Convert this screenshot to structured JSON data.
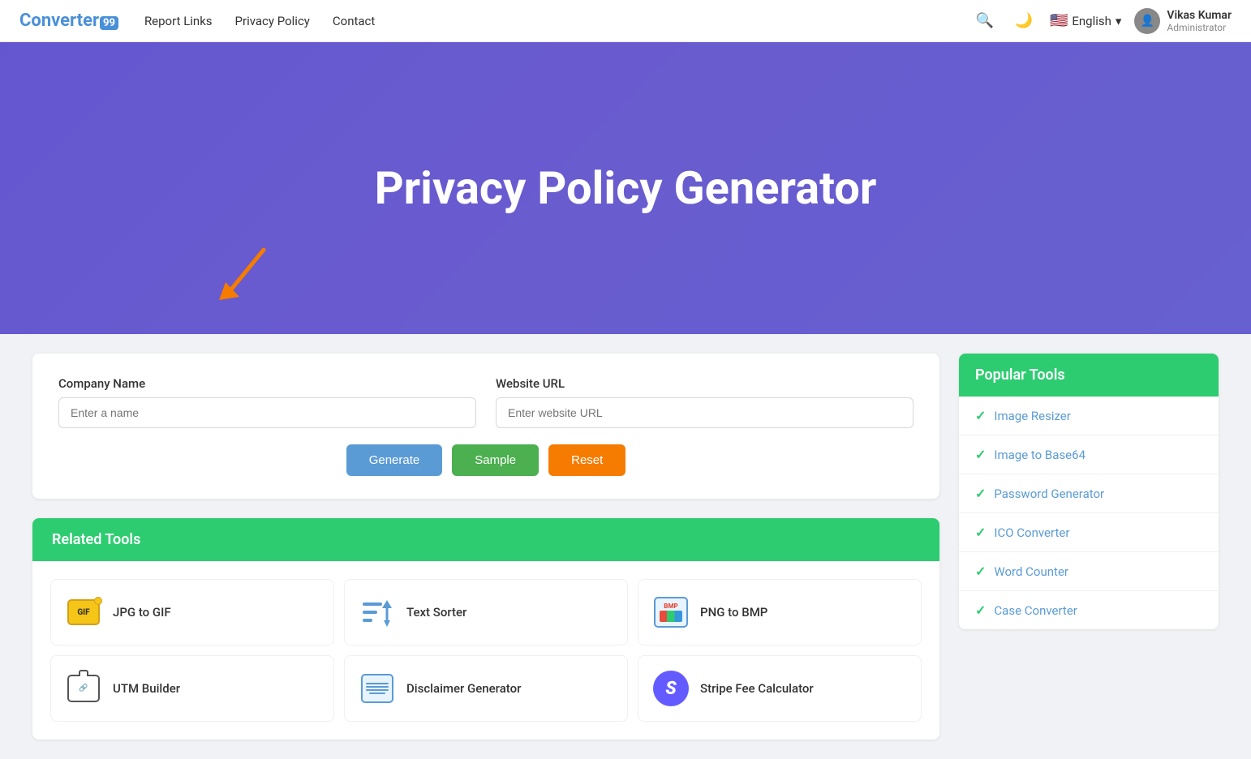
{
  "navbar": {
    "logo_text": "Converter",
    "logo_badge": "99",
    "links": [
      {
        "label": "Report Links",
        "href": "#"
      },
      {
        "label": "Privacy Policy",
        "href": "#"
      },
      {
        "label": "Contact",
        "href": "#"
      }
    ],
    "language": "English",
    "language_flag": "🇺🇸",
    "user": {
      "name": "Vikas Kumar",
      "role": "Administrator"
    },
    "search_icon": "🔍",
    "dark_mode_icon": "🌙"
  },
  "hero": {
    "title": "Privacy Policy Generator"
  },
  "form": {
    "company_name_label": "Company Name",
    "company_name_placeholder": "Enter a name",
    "website_url_label": "Website URL",
    "website_url_placeholder": "Enter website URL",
    "generate_button": "Generate",
    "sample_button": "Sample",
    "reset_button": "Reset"
  },
  "related_tools": {
    "header": "Related Tools",
    "tools": [
      {
        "name": "JPG to GIF",
        "icon_type": "gif"
      },
      {
        "name": "Text Sorter",
        "icon_type": "sort"
      },
      {
        "name": "PNG to BMP",
        "icon_type": "bmp"
      },
      {
        "name": "UTM Builder",
        "icon_type": "utm"
      },
      {
        "name": "Disclaimer Generator",
        "icon_type": "disclaimer"
      },
      {
        "name": "Stripe Fee Calculator",
        "icon_type": "stripe"
      }
    ]
  },
  "popular_tools": {
    "header": "Popular Tools",
    "tools": [
      {
        "name": "Image Resizer"
      },
      {
        "name": "Image to Base64"
      },
      {
        "name": "Password Generator"
      },
      {
        "name": "ICO Converter"
      },
      {
        "name": "Word Counter"
      },
      {
        "name": "Case Converter"
      }
    ]
  }
}
